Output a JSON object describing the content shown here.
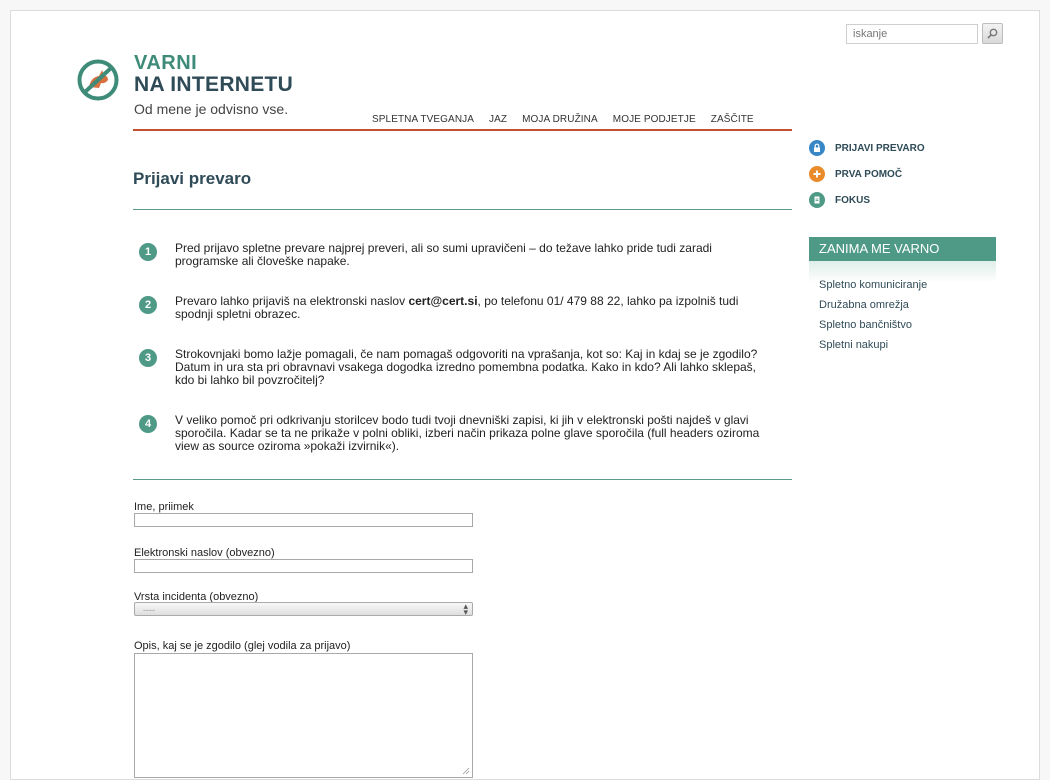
{
  "search": {
    "placeholder": "iskanje"
  },
  "logo": {
    "line1": "VARNI",
    "line2": "NA INTERNETU",
    "tagline": "Od mene je odvisno vse."
  },
  "nav": [
    "SPLETNA TVEGANJA",
    "JAZ",
    "MOJA DRUŽINA",
    "MOJE PODJETJE",
    "ZAŠČITE"
  ],
  "quick_links": [
    {
      "label": "PRIJAVI PREVARO",
      "icon": "lock-icon",
      "color": "#3a87c8"
    },
    {
      "label": "PRVA POMOČ",
      "icon": "plus-icon",
      "color": "#e98b2a"
    },
    {
      "label": "FOKUS",
      "icon": "document-icon",
      "color": "#4f9a86"
    }
  ],
  "page_title": "Prijavi prevaro",
  "steps": [
    {
      "num": "1",
      "text": "Pred prijavo spletne prevare najprej preveri, ali so sumi upravičeni – do težave lahko pride tudi zaradi programske ali človeške napake."
    },
    {
      "num": "2",
      "text_before": "Prevaro lahko prijaviš na elektronski naslov ",
      "email": "cert@cert.si",
      "text_after": ", po telefonu 01/ 479 88 22, lahko pa izpolniš tudi spodnji spletni obrazec."
    },
    {
      "num": "3",
      "text": "Strokovnjaki bomo lažje pomagali, če nam pomagaš odgovoriti na vprašanja, kot so: Kaj in kdaj se je zgodilo? Datum in ura sta pri obravnavi vsakega dogodka izredno pomembna podatka. Kako in kdo? Ali lahko sklepaš, kdo bi lahko bil povzročitelj?"
    },
    {
      "num": "4",
      "text": "V veliko pomoč pri odkrivanju storilcev bodo tudi tvoji dnevniški zapisi, ki jih v elektronski pošti najdeš v glavi sporočila. Kadar se ta ne prikaže v polni obliki, izberi način prikaza polne glave sporočila (full headers oziroma view as source oziroma »pokaži izvirnik«)."
    }
  ],
  "sidebar": {
    "header": "ZANIMA ME VARNO",
    "links": [
      "Spletno komuniciranje",
      "Družabna omrežja",
      "Spletno bančništvo",
      "Spletni nakupi"
    ]
  },
  "form": {
    "name_label": "Ime, priimek",
    "email_label": "Elektronski naslov (obvezno)",
    "type_label": "Vrsta incidenta (obvezno)",
    "type_value": "----",
    "desc_label": "Opis, kaj se je zgodilo (glej vodila za prijavo)"
  },
  "colors": {
    "accent_green": "#4f9a86",
    "accent_red": "#c0502e",
    "text_dark": "#2f4b57"
  }
}
